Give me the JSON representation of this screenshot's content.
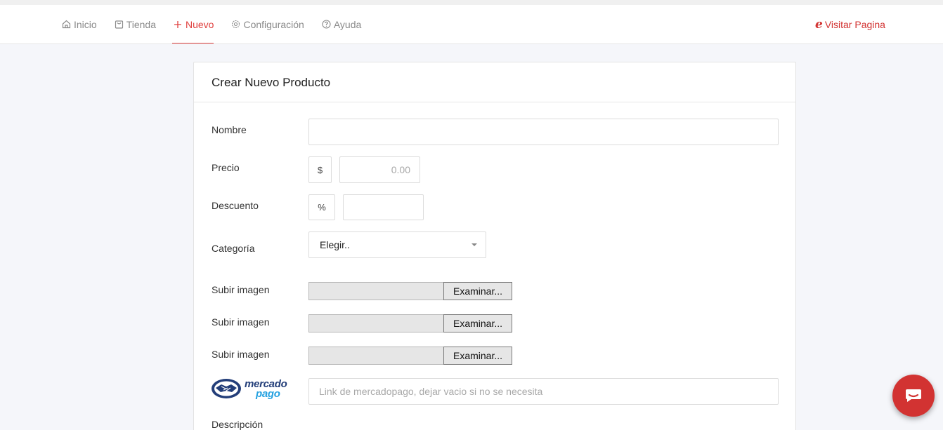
{
  "nav": {
    "items": [
      {
        "label": "Inicio",
        "icon": "home-icon"
      },
      {
        "label": "Tienda",
        "icon": "bag-icon"
      },
      {
        "label": "Nuevo",
        "icon": "plus-icon",
        "active": true
      },
      {
        "label": "Configuración",
        "icon": "gear-icon"
      },
      {
        "label": "Ayuda",
        "icon": "help-icon"
      }
    ],
    "visit_label": "Visitar Pagina",
    "accent_color": "#e0403f"
  },
  "form": {
    "title": "Crear Nuevo Producto",
    "nombre_label": "Nombre",
    "nombre_value": "",
    "precio_label": "Precio",
    "precio_addon": "$",
    "precio_placeholder": "0.00",
    "descuento_label": "Descuento",
    "descuento_addon": "%",
    "descuento_value": "",
    "categoria_label": "Categoría",
    "categoria_selected": "Elegir..",
    "uploads": [
      {
        "label": "Subir imagen",
        "button": "Examinar..."
      },
      {
        "label": "Subir imagen",
        "button": "Examinar..."
      },
      {
        "label": "Subir imagen",
        "button": "Examinar..."
      }
    ],
    "mercadopago_logo_top": "mercado",
    "mercadopago_logo_bottom": "pago",
    "mercadopago_placeholder": "Link de mercadopago, dejar vacio si no se necesita",
    "descripcion_label": "Descripción"
  },
  "chat": {
    "icon": "chat-icon",
    "color": "#d23332"
  }
}
